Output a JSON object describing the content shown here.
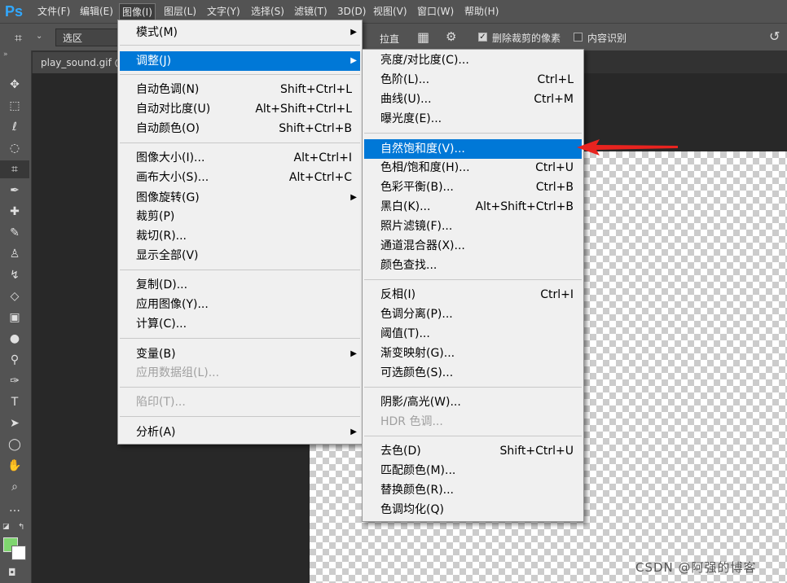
{
  "app": {
    "logo": "Ps"
  },
  "menubar": {
    "items": [
      "文件(F)",
      "编辑(E)",
      "图像(I)",
      "图层(L)",
      "文字(Y)",
      "选择(S)",
      "滤镜(T)",
      "3D(D)",
      "视图(V)",
      "窗口(W)",
      "帮助(H)"
    ],
    "active": "图像(I)"
  },
  "options_bar": {
    "preset": "选区",
    "straighten_label": "拉直",
    "delete_cropped_label": "删除裁剪的像素",
    "delete_cropped_checked": true,
    "content_aware_label": "内容识别",
    "content_aware_checked": false
  },
  "tab": {
    "title": "play_sound.gif @"
  },
  "toolbox": {
    "fg_color": "#7fd56f",
    "bg_color": "#ffffff"
  },
  "image_menu": {
    "items": [
      {
        "label": "模式(M)",
        "submenu": true
      },
      {
        "label": "调整(J)",
        "submenu": true,
        "highlighted": true
      },
      {
        "label": "自动色调(N)",
        "shortcut": "Shift+Ctrl+L"
      },
      {
        "label": "自动对比度(U)",
        "shortcut": "Alt+Shift+Ctrl+L"
      },
      {
        "label": "自动颜色(O)",
        "shortcut": "Shift+Ctrl+B"
      },
      {
        "label": "图像大小(I)...",
        "shortcut": "Alt+Ctrl+I"
      },
      {
        "label": "画布大小(S)...",
        "shortcut": "Alt+Ctrl+C"
      },
      {
        "label": "图像旋转(G)",
        "submenu": true
      },
      {
        "label": "裁剪(P)"
      },
      {
        "label": "裁切(R)..."
      },
      {
        "label": "显示全部(V)"
      },
      {
        "label": "复制(D)..."
      },
      {
        "label": "应用图像(Y)..."
      },
      {
        "label": "计算(C)..."
      },
      {
        "label": "变量(B)",
        "submenu": true
      },
      {
        "label": "应用数据组(L)...",
        "disabled": true
      },
      {
        "label": "陷印(T)...",
        "disabled": true
      },
      {
        "label": "分析(A)",
        "submenu": true
      }
    ]
  },
  "adjust_menu": {
    "items": [
      {
        "label": "亮度/对比度(C)..."
      },
      {
        "label": "色阶(L)...",
        "shortcut": "Ctrl+L"
      },
      {
        "label": "曲线(U)...",
        "shortcut": "Ctrl+M"
      },
      {
        "label": "曝光度(E)..."
      },
      {
        "label": "自然饱和度(V)...",
        "highlighted": true
      },
      {
        "label": "色相/饱和度(H)...",
        "shortcut": "Ctrl+U"
      },
      {
        "label": "色彩平衡(B)...",
        "shortcut": "Ctrl+B"
      },
      {
        "label": "黑白(K)...",
        "shortcut": "Alt+Shift+Ctrl+B"
      },
      {
        "label": "照片滤镜(F)..."
      },
      {
        "label": "通道混合器(X)..."
      },
      {
        "label": "颜色查找..."
      },
      {
        "label": "反相(I)",
        "shortcut": "Ctrl+I"
      },
      {
        "label": "色调分离(P)..."
      },
      {
        "label": "阈值(T)..."
      },
      {
        "label": "渐变映射(G)..."
      },
      {
        "label": "可选颜色(S)..."
      },
      {
        "label": "阴影/高光(W)..."
      },
      {
        "label": "HDR 色调...",
        "disabled": true
      },
      {
        "label": "去色(D)",
        "shortcut": "Shift+Ctrl+U"
      },
      {
        "label": "匹配颜色(M)..."
      },
      {
        "label": "替换颜色(R)..."
      },
      {
        "label": "色调均化(Q)"
      }
    ]
  },
  "highlight_color": "#0078d7",
  "annotation": {
    "arrow_color": "#e8231f"
  },
  "watermark": "CSDN @阿强的博客"
}
